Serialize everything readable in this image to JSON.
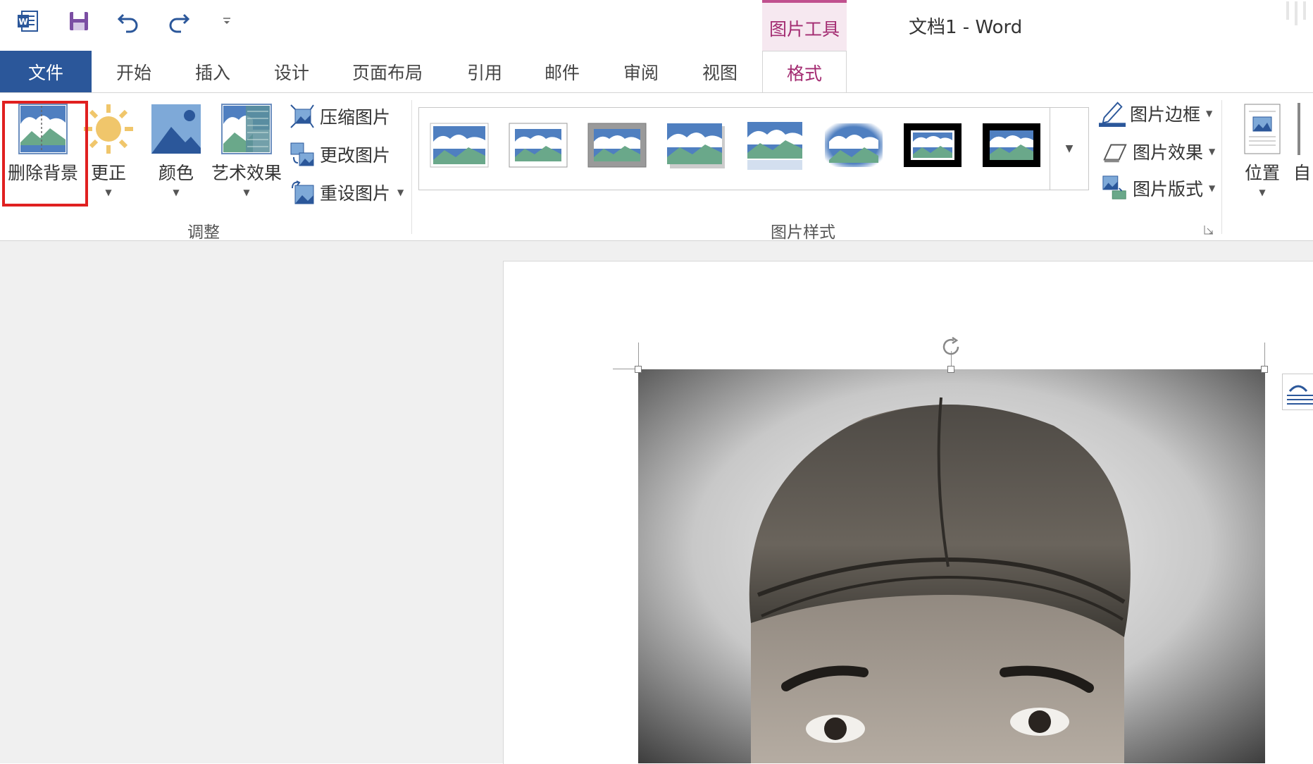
{
  "app": {
    "title": "文档1 - Word",
    "contextual_tab_group": "图片工具",
    "accent_color": "#2b579a",
    "contextual_color": "#a32b71"
  },
  "quick_access": {
    "icons": [
      "word-logo-icon",
      "save-icon",
      "undo-icon",
      "redo-icon",
      "customize-qat-icon"
    ]
  },
  "tabs": [
    {
      "label": "文件"
    },
    {
      "label": "开始"
    },
    {
      "label": "插入"
    },
    {
      "label": "设计"
    },
    {
      "label": "页面布局"
    },
    {
      "label": "引用"
    },
    {
      "label": "邮件"
    },
    {
      "label": "审阅"
    },
    {
      "label": "视图"
    },
    {
      "label": "格式",
      "active": true
    }
  ],
  "ribbon": {
    "adjust_group": {
      "label": "调整",
      "remove_background": "删除背景",
      "corrections": "更正",
      "color": "颜色",
      "artistic_effects": "艺术效果",
      "compress": "压缩图片",
      "change_picture": "更改图片",
      "reset_picture": "重设图片"
    },
    "styles_group": {
      "label": "图片样式",
      "border": "图片边框",
      "effects": "图片效果",
      "layout": "图片版式"
    },
    "arrange_group": {
      "position": "位置",
      "wrap_partial": "自"
    }
  }
}
